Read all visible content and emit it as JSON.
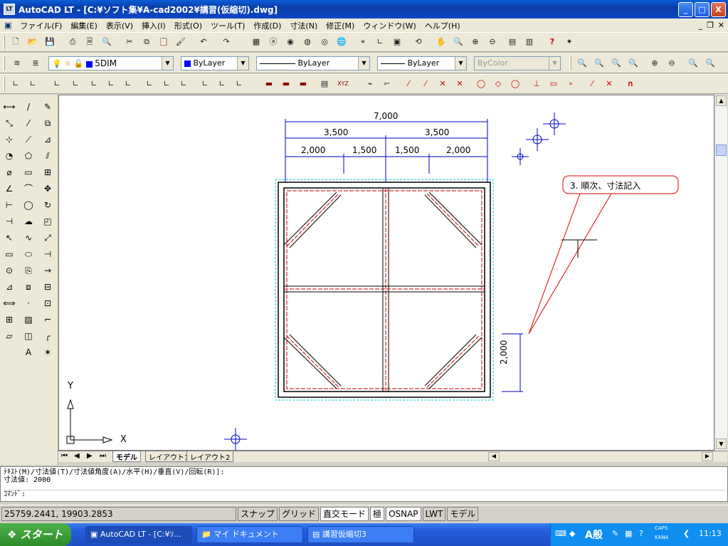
{
  "window": {
    "title": "AutoCAD LT - [C:¥ソフト集¥A-cad2002¥講習(仮縮切).dwg]",
    "minimize": "_",
    "maximize": "□",
    "close": "X"
  },
  "menu": [
    "ファイル(F)",
    "編集(E)",
    "表示(V)",
    "挿入(I)",
    "形式(O)",
    "ツール(T)",
    "作成(D)",
    "寸法(N)",
    "修正(M)",
    "ウィンドウ(W)",
    "ヘルプ(H)"
  ],
  "toolbars": {
    "layer_value": "5DIM",
    "color_value": "ByLayer",
    "linetype_value": "ByLayer",
    "lineweight_value": "ByLayer",
    "plotstyle_value": "ByColor"
  },
  "drawing": {
    "dimensions": {
      "top_total": "7,000",
      "mid_left": "3,500",
      "mid_right": "3,500",
      "bottom_1": "2,000",
      "bottom_2": "1,500",
      "bottom_3": "1,500",
      "bottom_4": "2,000",
      "right_vertical": "2,000"
    },
    "callout": "3. 順次、寸法記入",
    "ucs_y": "Y",
    "ucs_x": "X"
  },
  "tabs": [
    "モデル",
    "レイアウト1",
    "レイアウト2"
  ],
  "command": {
    "line1": "ﾃｷｽﾄ(M)/寸法値(T)/寸法値角度(A)/水平(H)/垂直(V)/回転(R)]:",
    "line2": "寸法値: 2000",
    "line3": "ｺﾏﾝﾄﾞ:"
  },
  "status": {
    "coords": "25759.2441, 19903.2853",
    "snap": "スナップ",
    "grid": "グリッド",
    "ortho": "直交モード",
    "polar": "極",
    "osnap": "OSNAP",
    "lwt": "LWT",
    "model": "モデル"
  },
  "taskbar": {
    "start": "スタート",
    "tasks": [
      "AutoCAD LT - [C:¥ｿ...",
      "マイ ドキュメント",
      "講習仮縮切3"
    ],
    "ime": "A般",
    "caps": "CAPS",
    "kana": "KANA",
    "clock": "11:13"
  }
}
